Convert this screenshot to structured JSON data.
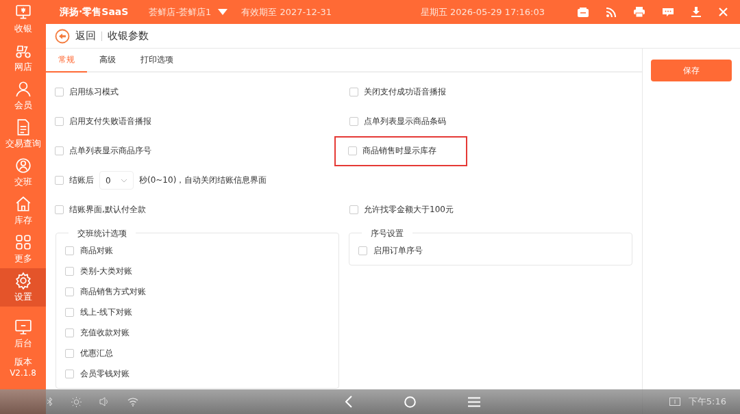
{
  "top_bar": {
    "brand": "湃扬·零售SaaS",
    "store": "荟鲜店-荟鲜店1",
    "expiry": "有效期至 2027-12-31",
    "datetime": "星期五 2026-05-29 17:16:03"
  },
  "sidebar": {
    "items": [
      {
        "label": "收银",
        "selected": false
      },
      {
        "label": "网店",
        "selected": false
      },
      {
        "label": "会员",
        "selected": false
      },
      {
        "label": "交易查询",
        "selected": false
      },
      {
        "label": "交班",
        "selected": false
      },
      {
        "label": "库存",
        "selected": false
      },
      {
        "label": "更多",
        "selected": false
      },
      {
        "label": "设置",
        "selected": true
      },
      {
        "label": "后台",
        "selected": false
      }
    ],
    "version_label": "版本",
    "version": "V2.1.8"
  },
  "header": {
    "back": "返回",
    "title": "收银参数"
  },
  "tabs": [
    {
      "label": "常规",
      "selected": true
    },
    {
      "label": "高级",
      "selected": false
    },
    {
      "label": "打印选项",
      "selected": false
    }
  ],
  "option_rows": [
    {
      "left": {
        "kind": "checkbox",
        "label": "启用练习模式",
        "checked": false,
        "highlighted": false
      },
      "right": {
        "kind": "checkbox",
        "label": "关闭支付成功语音播报",
        "checked": false,
        "highlighted": false
      }
    },
    {
      "left": {
        "kind": "checkbox",
        "label": "启用支付失败语音播报",
        "checked": false,
        "highlighted": false
      },
      "right": {
        "kind": "checkbox",
        "label": "点单列表显示商品条码",
        "checked": false,
        "highlighted": false
      }
    },
    {
      "left": {
        "kind": "checkbox",
        "label": "点单列表显示商品序号",
        "checked": false,
        "highlighted": false
      },
      "right": {
        "kind": "checkbox",
        "label": "商品销售时显示库存",
        "checked": false,
        "highlighted": true
      }
    },
    {
      "left": {
        "kind": "checkbox-select",
        "label": "结账后",
        "value": "0",
        "suffix": "秒(0~10)，自动关闭结账信息界面",
        "checked": false,
        "highlighted": false
      }
    },
    {
      "left": {
        "kind": "checkbox",
        "label": "结账界面,默认付全款",
        "checked": false,
        "highlighted": false
      },
      "right": {
        "kind": "checkbox",
        "label": "允许找零金额大于100元",
        "checked": false,
        "highlighted": false
      }
    }
  ],
  "groups": [
    {
      "title": "交班统计选项",
      "items": [
        {
          "label": "商品对账",
          "checked": false
        },
        {
          "label": "类别-大类对账",
          "checked": false
        },
        {
          "label": "商品销售方式对账",
          "checked": false
        },
        {
          "label": "线上-线下对账",
          "checked": false
        },
        {
          "label": "充值收款对账",
          "checked": false
        },
        {
          "label": "优惠汇总",
          "checked": false
        },
        {
          "label": "会员零钱对账",
          "checked": false
        }
      ]
    },
    {
      "title": "序号设置",
      "items": [
        {
          "label": "启用订单序号",
          "checked": false
        }
      ]
    }
  ],
  "save_button": "保存",
  "nav_bar": {
    "time": "下午5:16"
  }
}
